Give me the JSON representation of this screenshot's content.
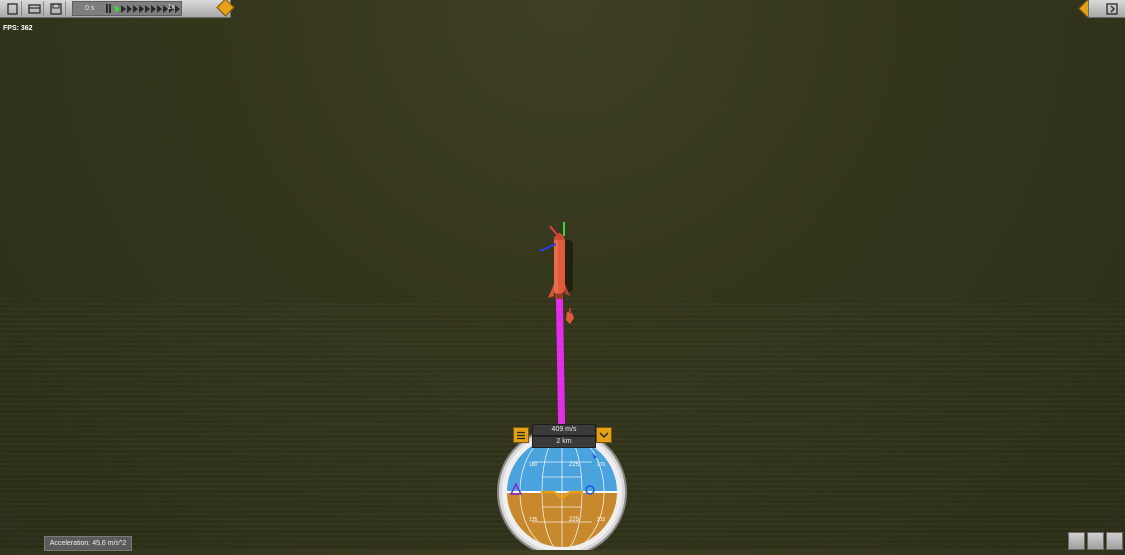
{
  "hud": {
    "fps_label": "FPS: 362",
    "time_text": "0 s",
    "warp_text": "1x",
    "warp_levels": 11,
    "warp_active_level": 1
  },
  "flight": {
    "velocity": "409 m/s",
    "altitude": "2 km",
    "acceleration": "Acceleration: 45,6 m/s^2"
  },
  "navball": {
    "heading_top": "225",
    "heading_bottom": "225",
    "pitch_labels": [
      "180",
      "270",
      "135",
      "315"
    ]
  },
  "colors": {
    "trail": "#e22ee8",
    "rocket": "#e05a3a",
    "accent": "#e6a11a",
    "sky": "#4aa3dc",
    "ground": "#c8892e"
  },
  "icons": {
    "toolbar": [
      "new-file-icon",
      "open-icon",
      "save-icon"
    ],
    "right_toolbar": [
      "exit-icon"
    ],
    "navball_left": "menu-icon",
    "navball_right": "chevron-down-icon"
  }
}
